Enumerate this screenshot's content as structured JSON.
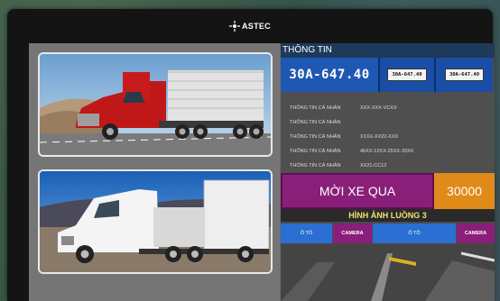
{
  "brand": {
    "logo_text": "ASTEC"
  },
  "info_panel": {
    "header": "THÔNG TIN",
    "plate_number": "30A-647.40",
    "plate_thumb_1": "30A-647.40",
    "plate_thumb_2": "30A-647.40",
    "rows": [
      {
        "label": "THÔNG TIN CÁ NHÂN",
        "value": "XXX-XXX-VCXX"
      },
      {
        "label": "THÔNG TIN CÁ NHÂN",
        "value": ""
      },
      {
        "label": "THÔNG TIN CÁ NHÂN",
        "value": "X1XX-XX22-XXX"
      },
      {
        "label": "THÔNG TIN CÁ NHÂN",
        "value": "46XX-12XX-25XX-33XX"
      },
      {
        "label": "THÔNG TIN CÁ NHÂN",
        "value": "XX21-CC12"
      }
    ],
    "pass_button": "MỜI XE QUA",
    "fee_value": "30000",
    "lane_header": "HÌNH ẢNH LUỒNG 3",
    "tabs": [
      {
        "label": "Ô TÔ",
        "style": "blue"
      },
      {
        "label": "CAMERA",
        "style": "purple"
      },
      {
        "label": "Ô TÔ",
        "style": "blue"
      },
      {
        "label": "CAMERA",
        "style": "purple"
      }
    ]
  },
  "colors": {
    "plate_blue": "#1e58b3",
    "pass_purple": "#8a1f7a",
    "fee_orange": "#e08a1a",
    "header_navy": "#1d3a5a"
  }
}
